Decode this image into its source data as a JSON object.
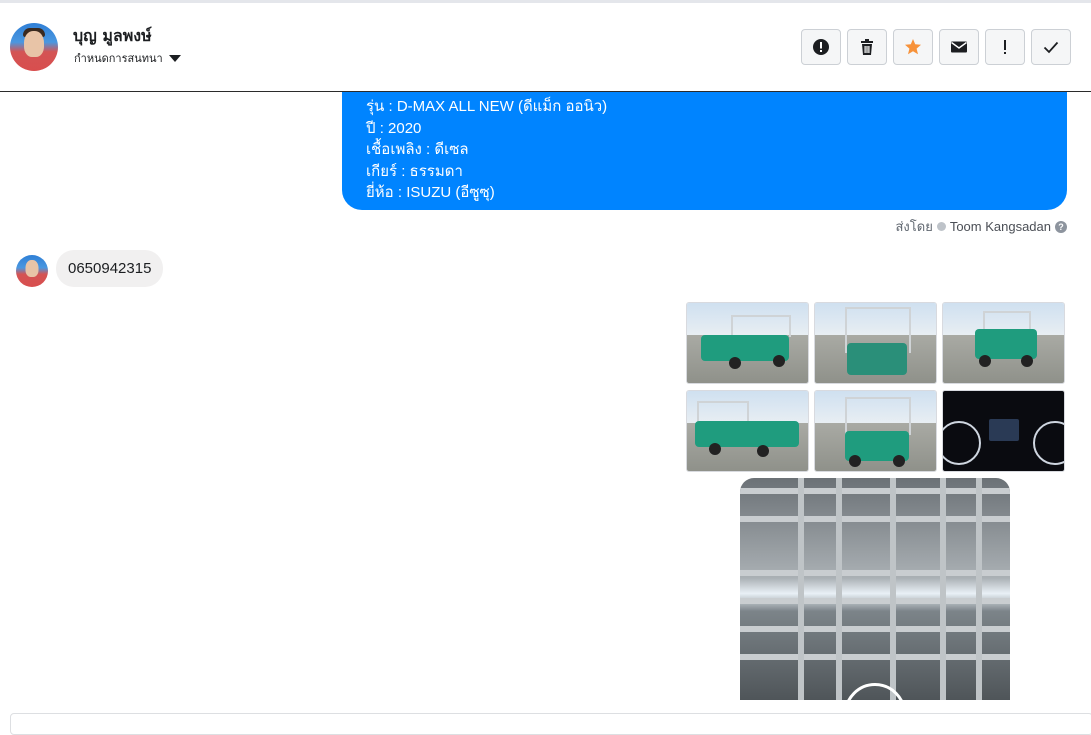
{
  "header": {
    "contact_name": "บุญ มูลพงษ์",
    "assign_label": "กำหนดการสนทนา",
    "actions": [
      {
        "icon": "exclamation-circle-icon"
      },
      {
        "icon": "trash-icon"
      },
      {
        "icon": "star-icon",
        "color": "#f7923a"
      },
      {
        "icon": "envelope-icon"
      },
      {
        "icon": "exclamation-icon"
      },
      {
        "icon": "check-icon"
      }
    ]
  },
  "outgoing_message": {
    "lines": [
      "รุ่น : D-MAX ALL NEW (ดีแม็ก ออนิว)",
      "ปี : 2020",
      "เชื้อเพลิง : ดีเซล",
      "เกียร์ : ธรรมดา",
      "ยี่ห้อ : ISUZU (อีซูซุ)"
    ],
    "sent_by_label": "ส่งโดย",
    "agent_name": "Toom Kangsadan",
    "help_symbol": "?",
    "bubble_color": "#0084ff"
  },
  "incoming_message": {
    "text": "0650942315"
  },
  "photo_grid": {
    "count": 6
  },
  "video": {
    "has_play_button": true
  }
}
